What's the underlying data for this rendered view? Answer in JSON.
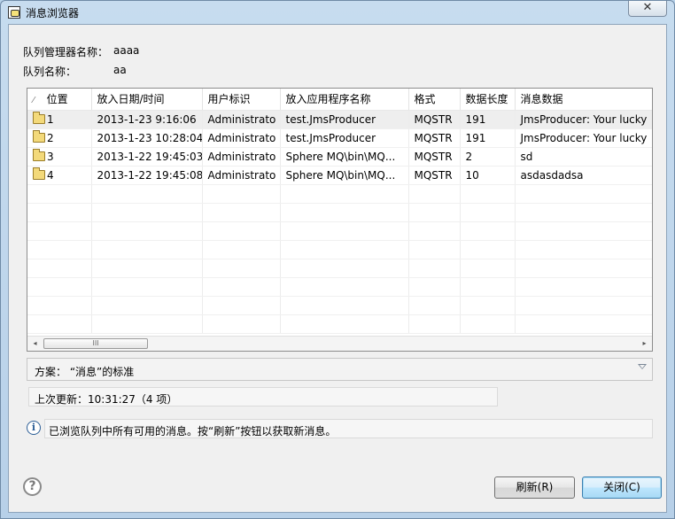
{
  "window": {
    "title": "消息浏览器",
    "close_glyph": "✕"
  },
  "fields": {
    "queue_manager_label": "队列管理器名称：",
    "queue_manager_value": "aaaa",
    "queue_label": "队列名称：",
    "queue_value": "aa"
  },
  "table": {
    "sort_glyph": "⁄",
    "columns": [
      "位置",
      "放入日期/时间",
      "用户标识",
      "放入应用程序名称",
      "格式",
      "数据长度",
      "消息数据"
    ],
    "rows": [
      {
        "position": "1",
        "put_datetime": "2013-1-23 9:16:06",
        "user_id": "Administrato",
        "app_name": "test.JmsProducer",
        "format": "MQSTR",
        "length": "191",
        "data": "JmsProducer: Your lucky"
      },
      {
        "position": "2",
        "put_datetime": "2013-1-23 10:28:04",
        "user_id": "Administrato",
        "app_name": "test.JmsProducer",
        "format": "MQSTR",
        "length": "191",
        "data": "JmsProducer: Your lucky"
      },
      {
        "position": "3",
        "put_datetime": "2013-1-22 19:45:03",
        "user_id": "Administrato",
        "app_name": "Sphere MQ\\bin\\MQ...",
        "format": "MQSTR",
        "length": "2",
        "data": "sd"
      },
      {
        "position": "4",
        "put_datetime": "2013-1-22 19:45:08",
        "user_id": "Administrato",
        "app_name": "Sphere MQ\\bin\\MQ...",
        "format": "MQSTR",
        "length": "10",
        "data": "asdasdadsa"
      }
    ],
    "empty_rows": 8,
    "scroll_left": "◂",
    "scroll_right": "▸",
    "scroll_thumb": "III"
  },
  "scheme": {
    "text": "方案：  “消息”的标准"
  },
  "status": {
    "last_update": "上次更新：10:31:27（4 项）"
  },
  "info": {
    "icon_glyph": "i",
    "message": "已浏览队列中所有可用的消息。按“刷新”按钮以获取新消息。"
  },
  "help": {
    "glyph": "?"
  },
  "buttons": {
    "refresh": "刷新(R)",
    "close": "关闭(C)"
  }
}
